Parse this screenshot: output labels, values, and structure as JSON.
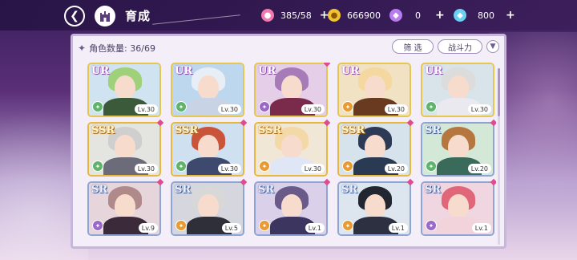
{
  "header": {
    "title": "育成",
    "back_icon": "back-arrow-icon",
    "home_icon": "castle-home-icon"
  },
  "resources": [
    {
      "icon": "candy-icon",
      "value": "385/58",
      "color": "#f07ab0"
    },
    {
      "icon": "gold-coin-icon",
      "value": "666900",
      "color": "#f2c230"
    },
    {
      "icon": "purple-gem-icon",
      "value": "0",
      "color": "#b67cf0"
    },
    {
      "icon": "blue-diamond-icon",
      "value": "800",
      "color": "#6ad0f2"
    }
  ],
  "panel": {
    "count_label": "角色数量: 36/69",
    "filter_label": "筛 选",
    "power_label": "战斗力",
    "sort_icon": "sort-chevron-icon"
  },
  "cards": [
    {
      "rarity": "UR",
      "level": "Lv.30",
      "elem": "wind",
      "elem_color": "#5fb36b",
      "hair": "#9fd07a",
      "outfit": "#3a5a3a",
      "bg": "#cfe3f0"
    },
    {
      "rarity": "UR",
      "level": "Lv.30",
      "elem": "wind",
      "elem_color": "#5fb36b",
      "hair": "#e8eef5",
      "outfit": "#c9d3e6",
      "bg": "#bcd7ee"
    },
    {
      "rarity": "UR",
      "level": "Lv.30",
      "elem": "dark",
      "elem_color": "#9a68c9",
      "hair": "#a77ab8",
      "outfit": "#7a2a4a",
      "bg": "#e5cfe8"
    },
    {
      "rarity": "UR",
      "level": "Lv.30",
      "elem": "fire",
      "elem_color": "#e89a33",
      "hair": "#f4d8a0",
      "outfit": "#6a3a20",
      "bg": "#f2e2c4"
    },
    {
      "rarity": "UR",
      "level": "Lv.30",
      "elem": "wind",
      "elem_color": "#5fb36b",
      "hair": "#dcdcdc",
      "outfit": "#e9e9ef",
      "bg": "#d8e4ea"
    },
    {
      "rarity": "SSR",
      "level": "Lv.30",
      "elem": "wind",
      "elem_color": "#5fb36b",
      "hair": "#cfcfcf",
      "outfit": "#6b6b7a",
      "bg": "#e4e4e0"
    },
    {
      "rarity": "SSR",
      "level": "Lv.30",
      "elem": "wind",
      "elem_color": "#5fb36b",
      "hair": "#c9543a",
      "outfit": "#3d4a6e",
      "bg": "#cfe0f0"
    },
    {
      "rarity": "SSR",
      "level": "Lv.30",
      "elem": "fire",
      "elem_color": "#e89a33",
      "hair": "#f3d9a8",
      "outfit": "#dfe6f5",
      "bg": "#f1e7d6"
    },
    {
      "rarity": "SSR",
      "level": "Lv.20",
      "elem": "fire",
      "elem_color": "#e89a33",
      "hair": "#2d3a55",
      "outfit": "#2a3a52",
      "bg": "#d6e3ec"
    },
    {
      "rarity": "SR",
      "level": "Lv.20",
      "elem": "wind",
      "elem_color": "#5fb36b",
      "hair": "#b5773f",
      "outfit": "#3a6a5a",
      "bg": "#d4e8d8"
    },
    {
      "rarity": "SR",
      "level": "Lv.9",
      "elem": "dark",
      "elem_color": "#9a68c9",
      "hair": "#b08a8a",
      "outfit": "#3a2a3a",
      "bg": "#e6d6dc"
    },
    {
      "rarity": "SR",
      "level": "Lv.5",
      "elem": "fire",
      "elem_color": "#e89a33",
      "hair": "#d8d8d8",
      "outfit": "#2f2f3a",
      "bg": "#d6d6de"
    },
    {
      "rarity": "SR",
      "level": "Lv.1",
      "elem": "fire",
      "elem_color": "#e89a33",
      "hair": "#6a5a8a",
      "outfit": "#3c3560",
      "bg": "#dad0ea"
    },
    {
      "rarity": "SR",
      "level": "Lv.1",
      "elem": "fire",
      "elem_color": "#e89a33",
      "hair": "#222630",
      "outfit": "#2c3040",
      "bg": "#dde6ee"
    },
    {
      "rarity": "SR",
      "level": "Lv.1",
      "elem": "dark",
      "elem_color": "#9a68c9",
      "hair": "#e0667a",
      "outfit": "#f2d3dc",
      "bg": "#f0d6e0"
    }
  ]
}
